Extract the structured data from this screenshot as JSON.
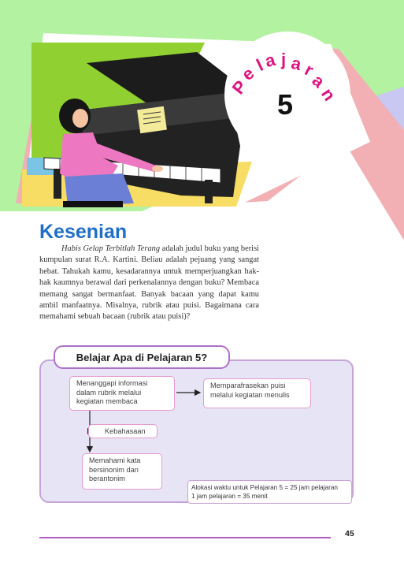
{
  "header": {
    "badge_word": "Pelajaran",
    "badge_letters": [
      "P",
      "e",
      "l",
      "a",
      "j",
      "a",
      "r",
      "a",
      "n"
    ],
    "lesson_number": "5",
    "illustration": "girl-playing-grand-piano"
  },
  "chapter": {
    "title": "Kesenian",
    "intro_italic": "Habis Gelap Terbitlah Terang",
    "intro_rest": " adalah judul buku yang berisi kumpulan surat R.A. Kartini. Beliau adalah pejuang yang sangat hebat. Tahukah kamu, kesadarannya untuk memperjuangkan hak-hak kaumnya berawal dari perkenalannya dengan buku? Membaca memang sangat bermanfaat. Banyak bacaan yang dapat kamu ambil manfaatnya. Misalnya, rubrik atau puisi. Bagaimana cara memahami sebuah bacaan (rubrik atau puisi)?"
  },
  "learning_map": {
    "heading": "Belajar Apa di Pelajaran 5?",
    "nodes": {
      "respond": "Menanggapi informasi dalam rubrik melalui kegiatan membaca",
      "paraphrase": "Memparafrasekan puisi melalui kegiatan menulis",
      "language": "Kebahasaan",
      "meaning": "Memahami kata bersinonim dan berantonim"
    },
    "time_allocation_line1": "Alokasi waktu untuk Pelajaran 5 = 25 jam pelajaran",
    "time_allocation_line2": "1 jam pelajaran = 35 menit"
  },
  "footer": {
    "page_number": "45"
  },
  "colors": {
    "title_blue": "#1f6fc9",
    "badge_pink": "#e0127f",
    "panel_lavender": "#e6e4f5",
    "panel_border": "#c7a4d8",
    "header_green": "#b2f2a0",
    "stripe_pink": "#f2b0b4",
    "stripe_lilac": "#c8c8f2",
    "footer_rule": "#b05cc2"
  }
}
